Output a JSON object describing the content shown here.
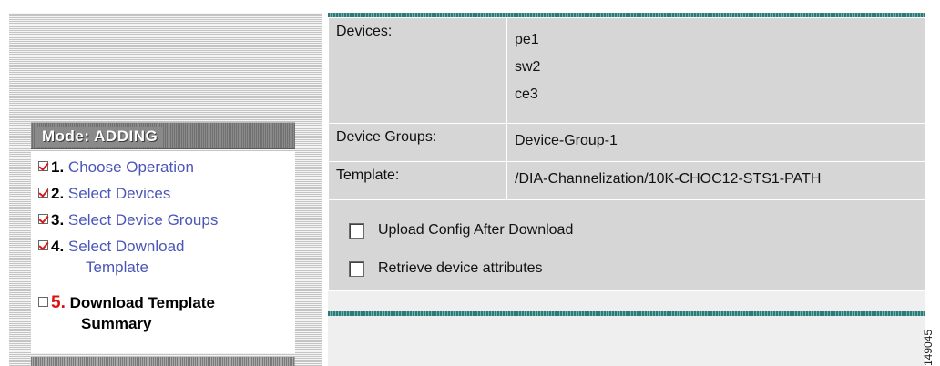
{
  "wizard": {
    "mode_label": "Mode: ADDING",
    "steps": [
      {
        "number": "1.",
        "label": "Choose Operation",
        "checked": true
      },
      {
        "number": "2.",
        "label": "Select Devices",
        "checked": true
      },
      {
        "number": "3.",
        "label": "Select Device Groups",
        "checked": true
      },
      {
        "number": "4.",
        "label": "Select Download",
        "label_cont": "Template",
        "checked": true
      },
      {
        "number": "5.",
        "label": "Download Template",
        "label_cont": "Summary",
        "checked": false,
        "current": true
      }
    ]
  },
  "summary": {
    "devices_label": "Devices:",
    "devices": [
      "pe1",
      "sw2",
      "ce3"
    ],
    "device_groups_label": "Device Groups:",
    "device_groups_value": "Device-Group-1",
    "template_label": "Template:",
    "template_value": "/DIA-Channelization/10K-CHOC12-STS1-PATH",
    "options": [
      {
        "label": "Upload Config After Download",
        "checked": false
      },
      {
        "label": "Retrieve device attributes",
        "checked": false
      }
    ]
  },
  "figure_id": "149045",
  "colors": {
    "link": "#4a56b8",
    "current_step_number": "#e01010",
    "check_mark": "#d81818",
    "rule": "#2d7a78",
    "table_bg": "#d6d6d6"
  }
}
